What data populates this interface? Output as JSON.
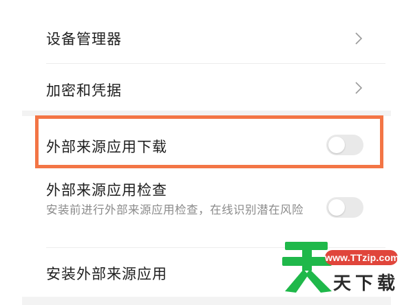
{
  "settings": {
    "device_manager": {
      "label": "设备管理器"
    },
    "credentials": {
      "label": "加密和凭据"
    },
    "external_download": {
      "label": "外部来源应用下载",
      "enabled": false
    },
    "external_check": {
      "label": "外部来源应用检查",
      "description": "安装前进行外部来源应用检查，在线识别潜在风险",
      "enabled": false
    },
    "install_external": {
      "label": "安装外部来源应用"
    }
  },
  "watermark": {
    "url": "www.TTzip.com",
    "text": "天下载",
    "brand_green": "#1fb84a",
    "brand_red": "#e0453b"
  },
  "colors": {
    "highlight_border": "#f37545",
    "toggle_off": "#e9e9e9"
  },
  "icons": {
    "chevron": "chevron-right-icon"
  }
}
